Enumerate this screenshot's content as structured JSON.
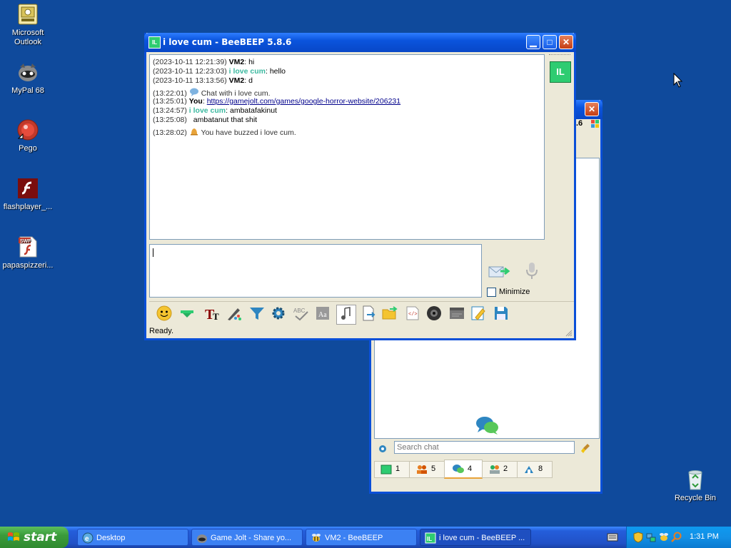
{
  "desktop": {
    "icons": [
      {
        "label": "Microsoft Outlook",
        "icon": "outlook-icon"
      },
      {
        "label": "MyPal 68",
        "icon": "mypal-icon"
      },
      {
        "label": "Pego",
        "icon": "pego-icon"
      },
      {
        "label": "flashplayer_...",
        "icon": "flash-icon"
      },
      {
        "label": "papaspizzeri...",
        "icon": "swf-file-icon"
      },
      {
        "label": "Recycle Bin",
        "icon": "recycle-bin-icon"
      }
    ]
  },
  "bg_window": {
    "title_fragment": ".6",
    "search_placeholder": "Search chat",
    "tabs": [
      {
        "count": "1",
        "icon": "user-icon"
      },
      {
        "count": "5",
        "icon": "users-icon"
      },
      {
        "count": "4",
        "icon": "chats-icon"
      },
      {
        "count": "2",
        "icon": "groups-icon"
      },
      {
        "count": "8",
        "icon": "share-icon"
      }
    ]
  },
  "chat_window": {
    "title": "i love cum - BeeBEEP 5.8.6",
    "avatar_initials": "IL",
    "messages": [
      {
        "time": "(2023-10-11 12:21:39)",
        "user": "VM2",
        "text": ": hi",
        "kind": "self-user"
      },
      {
        "time": "(2023-10-11 12:23:03)",
        "user": "i love cum",
        "text": ": hello",
        "kind": "peer"
      },
      {
        "time": "(2023-10-11 13:13:56)",
        "user": "VM2",
        "text": ": d",
        "kind": "self-user"
      },
      {
        "time": "(13:22:01)",
        "text": "Chat with i love cum.",
        "kind": "system"
      },
      {
        "time": "(13:25:01)",
        "user": "You",
        "text": ": ",
        "link": "https://gamejolt.com/games/google-horror-website/206231",
        "kind": "you"
      },
      {
        "time": "(13:24:57)",
        "user": "i love cum",
        "text": ": ambatafakinut",
        "kind": "peer"
      },
      {
        "time": "(13:25:08)",
        "text": "ambatanut that shit",
        "kind": "plain"
      },
      {
        "time": "(13:28:02)",
        "text": "You have buzzed i love cum.",
        "kind": "system"
      }
    ],
    "minimize_label": "Minimize",
    "status": "Ready."
  },
  "taskbar": {
    "start_label": "start",
    "tasks": [
      {
        "label": "Desktop"
      },
      {
        "label": "Game Jolt - Share yo..."
      },
      {
        "label": "VM2 - BeeBEEP"
      },
      {
        "label": "i love cum - BeeBEEP ..."
      }
    ],
    "clock": "1:31 PM"
  }
}
